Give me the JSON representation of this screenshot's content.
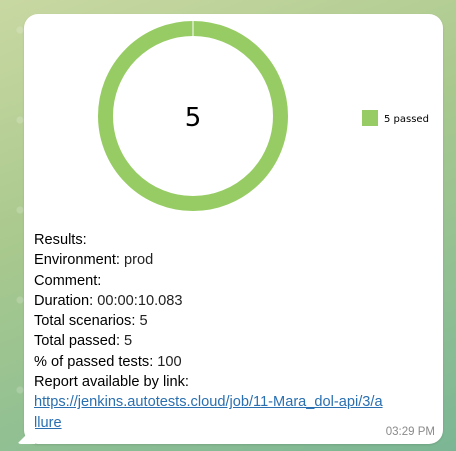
{
  "chart_data": {
    "type": "pie",
    "center_label": "5",
    "slices": [
      {
        "label": "5 passed",
        "value": 5,
        "color": "#97cc64"
      }
    ],
    "legend_position": "right"
  },
  "message": {
    "lines": [
      {
        "label": "Results:",
        "value": ""
      },
      {
        "label": "Environment:",
        "value": " prod"
      },
      {
        "label": "Comment:",
        "value": ""
      },
      {
        "label": "Duration:",
        "value": " 00:00:10.083"
      },
      {
        "label": "Total scenarios:",
        "value": " 5"
      },
      {
        "label": "Total passed:",
        "value": " 5"
      },
      {
        "label": "% of passed tests:",
        "value": " 100"
      },
      {
        "label": "Report available by link:",
        "value": ""
      }
    ],
    "link": "https://jenkins.autotests.cloud/job/11-Mara_dol-api/3/allure",
    "time": "03:29 PM"
  }
}
